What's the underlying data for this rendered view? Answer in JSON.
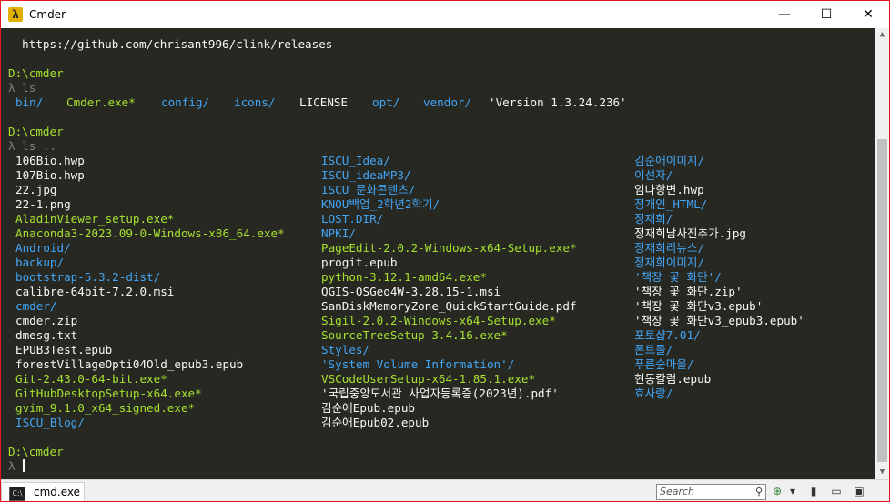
{
  "window": {
    "title": "Cmder",
    "app_icon": "λ",
    "minimize": "—",
    "maximize": "☐",
    "close": "✕"
  },
  "colors": {
    "prompt": "#a6e22e",
    "lambda": "#808080",
    "directory": "#42a5f5",
    "executable": "#a6e22e",
    "text": "#f8f8f2",
    "background": "#272822"
  },
  "terminal": {
    "url_line": "  https://github.com/chrisant996/clink/releases",
    "prompt_path": "D:\\cmder",
    "lambda": "λ",
    "cmd1": "λ ls",
    "ls_output": [
      {
        "text": "bin/",
        "kind": "dir"
      },
      {
        "text": "Cmder.exe*",
        "kind": "exe"
      },
      {
        "text": "config/",
        "kind": "dir"
      },
      {
        "text": "icons/",
        "kind": "dir"
      },
      {
        "text": "LICENSE",
        "kind": "text"
      },
      {
        "text": "opt/",
        "kind": "dir"
      },
      {
        "text": "vendor/",
        "kind": "dir"
      },
      {
        "text": "'Version 1.3.24.236'",
        "kind": "text"
      }
    ],
    "cmd2": "λ ls ..",
    "columns": [
      [
        {
          "text": "106Bio.hwp",
          "kind": "text"
        },
        {
          "text": "107Bio.hwp",
          "kind": "text"
        },
        {
          "text": "22.jpg",
          "kind": "text"
        },
        {
          "text": "22-1.png",
          "kind": "text"
        },
        {
          "text": "AladinViewer_setup.exe*",
          "kind": "exe"
        },
        {
          "text": "Anaconda3-2023.09-0-Windows-x86_64.exe*",
          "kind": "exe"
        },
        {
          "text": "Android/",
          "kind": "dir"
        },
        {
          "text": "backup/",
          "kind": "dir"
        },
        {
          "text": "bootstrap-5.3.2-dist/",
          "kind": "dir"
        },
        {
          "text": "calibre-64bit-7.2.0.msi",
          "kind": "text"
        },
        {
          "text": "cmder/",
          "kind": "dir"
        },
        {
          "text": "cmder.zip",
          "kind": "text"
        },
        {
          "text": "dmesg.txt",
          "kind": "text"
        },
        {
          "text": "EPUB3Test.epub",
          "kind": "text"
        },
        {
          "text": "forestVillageOpti04Old_epub3.epub",
          "kind": "text"
        },
        {
          "text": "Git-2.43.0-64-bit.exe*",
          "kind": "exe"
        },
        {
          "text": "GitHubDesktopSetup-x64.exe*",
          "kind": "exe"
        },
        {
          "text": "gvim_9.1.0_x64_signed.exe*",
          "kind": "exe"
        },
        {
          "text": "ISCU_Blog/",
          "kind": "dir"
        }
      ],
      [
        {
          "text": "ISCU_Idea/",
          "kind": "dir"
        },
        {
          "text": "ISCU_ideaMP3/",
          "kind": "dir"
        },
        {
          "text": "ISCU_문화콘텐츠/",
          "kind": "dir"
        },
        {
          "text": "KNOU백업_2학년2학기/",
          "kind": "dir"
        },
        {
          "text": "LOST.DIR/",
          "kind": "dir"
        },
        {
          "text": "NPKI/",
          "kind": "dir"
        },
        {
          "text": "PageEdit-2.0.2-Windows-x64-Setup.exe*",
          "kind": "exe"
        },
        {
          "text": "progit.epub",
          "kind": "text"
        },
        {
          "text": "python-3.12.1-amd64.exe*",
          "kind": "exe"
        },
        {
          "text": "QGIS-OSGeo4W-3.28.15-1.msi",
          "kind": "text"
        },
        {
          "text": "SanDiskMemoryZone_QuickStartGuide.pdf",
          "kind": "text"
        },
        {
          "text": "Sigil-2.0.2-Windows-x64-Setup.exe*",
          "kind": "exe"
        },
        {
          "text": "SourceTreeSetup-3.4.16.exe*",
          "kind": "exe"
        },
        {
          "text": "Styles/",
          "kind": "dir"
        },
        {
          "text": "'System Volume Information'/",
          "kind": "dir"
        },
        {
          "text": "VSCodeUserSetup-x64-1.85.1.exe*",
          "kind": "exe"
        },
        {
          "text": "'국립중앙도서관 사업자등록증(2023년).pdf'",
          "kind": "text"
        },
        {
          "text": "김순애Epub.epub",
          "kind": "text"
        },
        {
          "text": "김순애Epub02.epub",
          "kind": "text"
        }
      ],
      [
        {
          "text": "김순애이미지/",
          "kind": "dir"
        },
        {
          "text": "이선자/",
          "kind": "dir"
        },
        {
          "text": "임나항변.hwp",
          "kind": "text"
        },
        {
          "text": "정개인_HTML/",
          "kind": "dir"
        },
        {
          "text": "정재희/",
          "kind": "dir"
        },
        {
          "text": "정재희남사진추가.jpg",
          "kind": "text"
        },
        {
          "text": "정재희리뉴스/",
          "kind": "dir"
        },
        {
          "text": "정재희이미지/",
          "kind": "dir"
        },
        {
          "text": "'책장 꽃 화단'/",
          "kind": "dir"
        },
        {
          "text": "'책장 꽃 화단.zip'",
          "kind": "text"
        },
        {
          "text": "'책장 꽃 화단v3.epub'",
          "kind": "text"
        },
        {
          "text": "'책장 꽃 화단v3_epub3.epub'",
          "kind": "text"
        },
        {
          "text": "포토샵7.01/",
          "kind": "dir"
        },
        {
          "text": "폰트들/",
          "kind": "dir"
        },
        {
          "text": "푸른숲마을/",
          "kind": "dir"
        },
        {
          "text": "현동칼럼.epub",
          "kind": "text"
        },
        {
          "text": "효사랑/",
          "kind": "dir"
        }
      ]
    ],
    "final_lambda": "λ "
  },
  "statusbar": {
    "tab_label": "cmd.exe",
    "tab_icon": "C:\\",
    "search_placeholder": "Search",
    "search_icon": "⚲",
    "add_tab": "⊕",
    "dropdown": "▾",
    "icon_a": "▮",
    "icon_b": "▭",
    "icon_c": "▣"
  }
}
